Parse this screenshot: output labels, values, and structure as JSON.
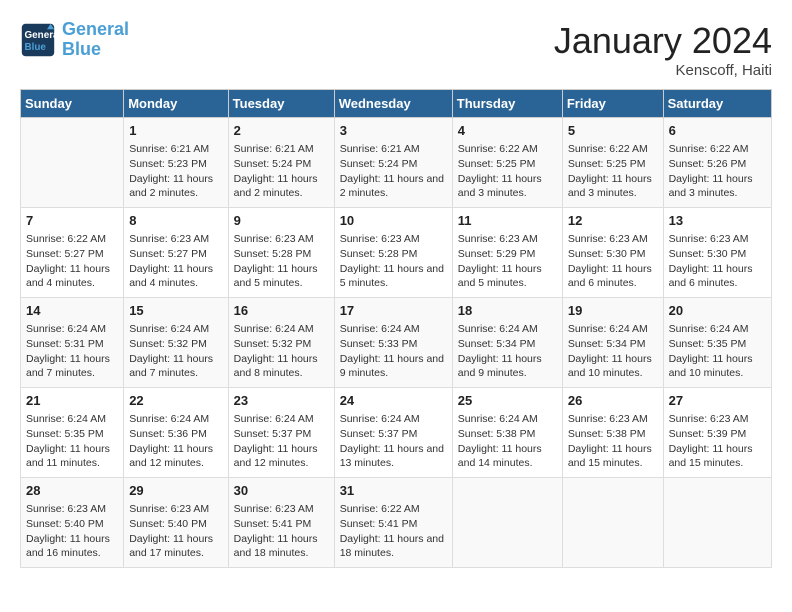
{
  "header": {
    "logo_line1": "General",
    "logo_line2": "Blue",
    "month_title": "January 2024",
    "location": "Kenscoff, Haiti"
  },
  "days_of_week": [
    "Sunday",
    "Monday",
    "Tuesday",
    "Wednesday",
    "Thursday",
    "Friday",
    "Saturday"
  ],
  "weeks": [
    [
      {
        "day": "",
        "sunrise": "",
        "sunset": "",
        "daylight": ""
      },
      {
        "day": "1",
        "sunrise": "Sunrise: 6:21 AM",
        "sunset": "Sunset: 5:23 PM",
        "daylight": "Daylight: 11 hours and 2 minutes."
      },
      {
        "day": "2",
        "sunrise": "Sunrise: 6:21 AM",
        "sunset": "Sunset: 5:24 PM",
        "daylight": "Daylight: 11 hours and 2 minutes."
      },
      {
        "day": "3",
        "sunrise": "Sunrise: 6:21 AM",
        "sunset": "Sunset: 5:24 PM",
        "daylight": "Daylight: 11 hours and 2 minutes."
      },
      {
        "day": "4",
        "sunrise": "Sunrise: 6:22 AM",
        "sunset": "Sunset: 5:25 PM",
        "daylight": "Daylight: 11 hours and 3 minutes."
      },
      {
        "day": "5",
        "sunrise": "Sunrise: 6:22 AM",
        "sunset": "Sunset: 5:25 PM",
        "daylight": "Daylight: 11 hours and 3 minutes."
      },
      {
        "day": "6",
        "sunrise": "Sunrise: 6:22 AM",
        "sunset": "Sunset: 5:26 PM",
        "daylight": "Daylight: 11 hours and 3 minutes."
      }
    ],
    [
      {
        "day": "7",
        "sunrise": "Sunrise: 6:22 AM",
        "sunset": "Sunset: 5:27 PM",
        "daylight": "Daylight: 11 hours and 4 minutes."
      },
      {
        "day": "8",
        "sunrise": "Sunrise: 6:23 AM",
        "sunset": "Sunset: 5:27 PM",
        "daylight": "Daylight: 11 hours and 4 minutes."
      },
      {
        "day": "9",
        "sunrise": "Sunrise: 6:23 AM",
        "sunset": "Sunset: 5:28 PM",
        "daylight": "Daylight: 11 hours and 5 minutes."
      },
      {
        "day": "10",
        "sunrise": "Sunrise: 6:23 AM",
        "sunset": "Sunset: 5:28 PM",
        "daylight": "Daylight: 11 hours and 5 minutes."
      },
      {
        "day": "11",
        "sunrise": "Sunrise: 6:23 AM",
        "sunset": "Sunset: 5:29 PM",
        "daylight": "Daylight: 11 hours and 5 minutes."
      },
      {
        "day": "12",
        "sunrise": "Sunrise: 6:23 AM",
        "sunset": "Sunset: 5:30 PM",
        "daylight": "Daylight: 11 hours and 6 minutes."
      },
      {
        "day": "13",
        "sunrise": "Sunrise: 6:23 AM",
        "sunset": "Sunset: 5:30 PM",
        "daylight": "Daylight: 11 hours and 6 minutes."
      }
    ],
    [
      {
        "day": "14",
        "sunrise": "Sunrise: 6:24 AM",
        "sunset": "Sunset: 5:31 PM",
        "daylight": "Daylight: 11 hours and 7 minutes."
      },
      {
        "day": "15",
        "sunrise": "Sunrise: 6:24 AM",
        "sunset": "Sunset: 5:32 PM",
        "daylight": "Daylight: 11 hours and 7 minutes."
      },
      {
        "day": "16",
        "sunrise": "Sunrise: 6:24 AM",
        "sunset": "Sunset: 5:32 PM",
        "daylight": "Daylight: 11 hours and 8 minutes."
      },
      {
        "day": "17",
        "sunrise": "Sunrise: 6:24 AM",
        "sunset": "Sunset: 5:33 PM",
        "daylight": "Daylight: 11 hours and 9 minutes."
      },
      {
        "day": "18",
        "sunrise": "Sunrise: 6:24 AM",
        "sunset": "Sunset: 5:34 PM",
        "daylight": "Daylight: 11 hours and 9 minutes."
      },
      {
        "day": "19",
        "sunrise": "Sunrise: 6:24 AM",
        "sunset": "Sunset: 5:34 PM",
        "daylight": "Daylight: 11 hours and 10 minutes."
      },
      {
        "day": "20",
        "sunrise": "Sunrise: 6:24 AM",
        "sunset": "Sunset: 5:35 PM",
        "daylight": "Daylight: 11 hours and 10 minutes."
      }
    ],
    [
      {
        "day": "21",
        "sunrise": "Sunrise: 6:24 AM",
        "sunset": "Sunset: 5:35 PM",
        "daylight": "Daylight: 11 hours and 11 minutes."
      },
      {
        "day": "22",
        "sunrise": "Sunrise: 6:24 AM",
        "sunset": "Sunset: 5:36 PM",
        "daylight": "Daylight: 11 hours and 12 minutes."
      },
      {
        "day": "23",
        "sunrise": "Sunrise: 6:24 AM",
        "sunset": "Sunset: 5:37 PM",
        "daylight": "Daylight: 11 hours and 12 minutes."
      },
      {
        "day": "24",
        "sunrise": "Sunrise: 6:24 AM",
        "sunset": "Sunset: 5:37 PM",
        "daylight": "Daylight: 11 hours and 13 minutes."
      },
      {
        "day": "25",
        "sunrise": "Sunrise: 6:24 AM",
        "sunset": "Sunset: 5:38 PM",
        "daylight": "Daylight: 11 hours and 14 minutes."
      },
      {
        "day": "26",
        "sunrise": "Sunrise: 6:23 AM",
        "sunset": "Sunset: 5:38 PM",
        "daylight": "Daylight: 11 hours and 15 minutes."
      },
      {
        "day": "27",
        "sunrise": "Sunrise: 6:23 AM",
        "sunset": "Sunset: 5:39 PM",
        "daylight": "Daylight: 11 hours and 15 minutes."
      }
    ],
    [
      {
        "day": "28",
        "sunrise": "Sunrise: 6:23 AM",
        "sunset": "Sunset: 5:40 PM",
        "daylight": "Daylight: 11 hours and 16 minutes."
      },
      {
        "day": "29",
        "sunrise": "Sunrise: 6:23 AM",
        "sunset": "Sunset: 5:40 PM",
        "daylight": "Daylight: 11 hours and 17 minutes."
      },
      {
        "day": "30",
        "sunrise": "Sunrise: 6:23 AM",
        "sunset": "Sunset: 5:41 PM",
        "daylight": "Daylight: 11 hours and 18 minutes."
      },
      {
        "day": "31",
        "sunrise": "Sunrise: 6:22 AM",
        "sunset": "Sunset: 5:41 PM",
        "daylight": "Daylight: 11 hours and 18 minutes."
      },
      {
        "day": "",
        "sunrise": "",
        "sunset": "",
        "daylight": ""
      },
      {
        "day": "",
        "sunrise": "",
        "sunset": "",
        "daylight": ""
      },
      {
        "day": "",
        "sunrise": "",
        "sunset": "",
        "daylight": ""
      }
    ]
  ]
}
